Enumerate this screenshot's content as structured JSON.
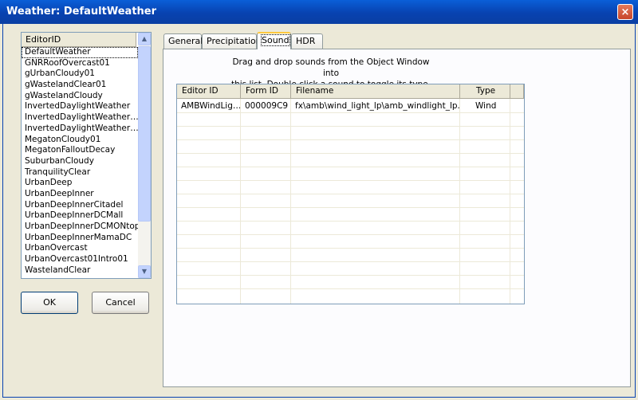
{
  "window": {
    "title": "Weather: DefaultWeather",
    "close_glyph": "×"
  },
  "editor_list": {
    "header": "EditorID",
    "items": [
      "DefaultWeather",
      "GNRRoofOvercast01",
      "gUrbanCloudy01",
      "gWastelandClear01",
      "gWastelandCloudy",
      "InvertedDaylightWeather",
      "InvertedDaylightWeather…",
      "InvertedDaylightWeather…",
      "MegatonCloudy01",
      "MegatonFalloutDecay",
      "SuburbanCloudy",
      "TranquilityClear",
      "UrbanDeep",
      "UrbanDeepInner",
      "UrbanDeepInnerCitadel",
      "UrbanDeepInnerDCMall",
      "UrbanDeepInnerDCMONtop",
      "UrbanDeepInnerMamaDC",
      "UrbanOvercast",
      "UrbanOvercast01Intro01",
      "WastelandClear"
    ],
    "selected_index": 0
  },
  "buttons": {
    "ok": "OK",
    "cancel": "Cancel"
  },
  "tabs": [
    {
      "label": "General"
    },
    {
      "label": "Precipitation"
    },
    {
      "label": "Sound",
      "active": true
    },
    {
      "label": "HDR"
    }
  ],
  "sound_tab": {
    "instruction_line1": "Drag and drop sounds from the Object Window into",
    "instruction_line2": "this list.  Double click a sound to toggle its type.",
    "columns": [
      "Editor ID",
      "Form ID",
      "Filename",
      "Type"
    ],
    "rows": [
      {
        "editor_id": "AMBWindLig…",
        "form_id": "000009C9",
        "filename": "fx\\amb\\wind_light_lp\\amb_windlight_lp.…",
        "type": "Wind"
      }
    ]
  },
  "icons": {
    "scroll_up": "chevron-up-icon",
    "scroll_down": "chevron-down-icon",
    "close": "close-icon"
  },
  "colors": {
    "titlebar": "#0842b0",
    "face": "#ece9d8",
    "active_tab_accent": "#ffc83c"
  }
}
